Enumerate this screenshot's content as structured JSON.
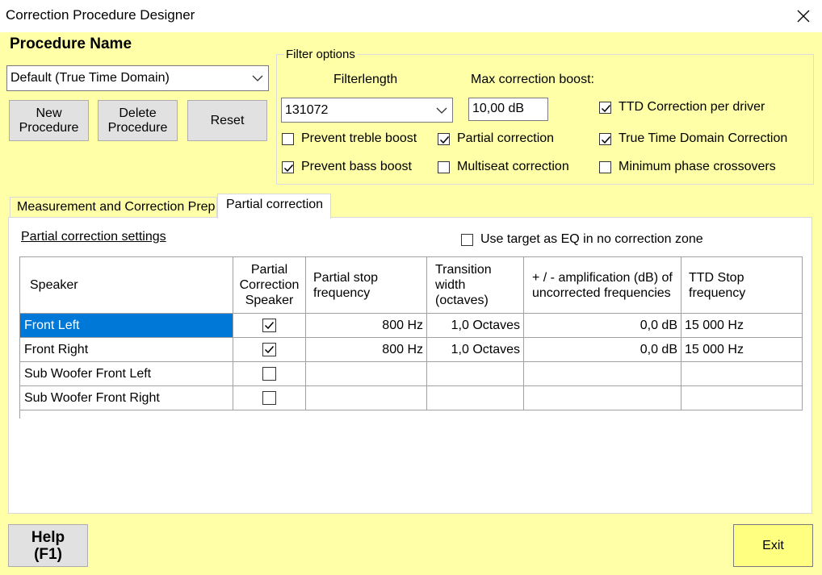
{
  "window": {
    "title": "Correction Procedure Designer"
  },
  "procedure": {
    "heading": "Procedure Name",
    "selected": "Default (True Time Domain)",
    "buttons": {
      "new": "New Procedure",
      "delete": "Delete Procedure",
      "reset": "Reset"
    }
  },
  "filter_options": {
    "legend": "Filter options",
    "filterlength_label": "Filterlength",
    "filterlength_value": "131072",
    "max_boost_label": "Max correction boost:",
    "max_boost_value": "10,00 dB",
    "checkboxes": {
      "ttd_per_driver": {
        "label": "TTD Correction per driver",
        "checked": true
      },
      "prevent_treble": {
        "label": "Prevent treble boost",
        "checked": false
      },
      "partial": {
        "label": "Partial correction",
        "checked": true
      },
      "true_time_domain": {
        "label": "True Time Domain Correction",
        "checked": true
      },
      "prevent_bass": {
        "label": "Prevent bass boost",
        "checked": true
      },
      "multiseat": {
        "label": "Multiseat correction",
        "checked": false
      },
      "min_phase": {
        "label": "Minimum phase crossovers",
        "checked": false
      }
    }
  },
  "tabs": [
    {
      "label": "Measurement and Correction Prep",
      "active": false
    },
    {
      "label": "Partial correction",
      "active": true
    }
  ],
  "partial": {
    "section_title": "Partial correction settings",
    "use_target_label": "Use target as EQ in no correction zone",
    "use_target_checked": false,
    "columns": [
      "Speaker",
      "Partial Correction Speaker",
      "Partial stop frequency",
      "Transition width (octaves)",
      "+ / - amplification (dB) of uncorrected frequencies",
      "TTD Stop frequency"
    ],
    "rows": [
      {
        "speaker": "Front Left",
        "checked": true,
        "stop": "800 Hz",
        "width": "1,0 Octaves",
        "amp": "0,0 dB",
        "ttd": "15 000 Hz",
        "selected": true
      },
      {
        "speaker": "Front Right",
        "checked": true,
        "stop": "800 Hz",
        "width": "1,0 Octaves",
        "amp": "0,0 dB",
        "ttd": "15 000 Hz",
        "selected": false
      },
      {
        "speaker": "Sub Woofer Front Left",
        "checked": false,
        "stop": "",
        "width": "",
        "amp": "",
        "ttd": "",
        "selected": false
      },
      {
        "speaker": "Sub Woofer Front Right",
        "checked": false,
        "stop": "",
        "width": "",
        "amp": "",
        "ttd": "",
        "selected": false
      }
    ]
  },
  "footer": {
    "help": "Help (F1)",
    "exit": "Exit"
  },
  "colors": {
    "background": "#ffffa8",
    "exit_button": "#ffff80",
    "selection": "#0078d7"
  }
}
